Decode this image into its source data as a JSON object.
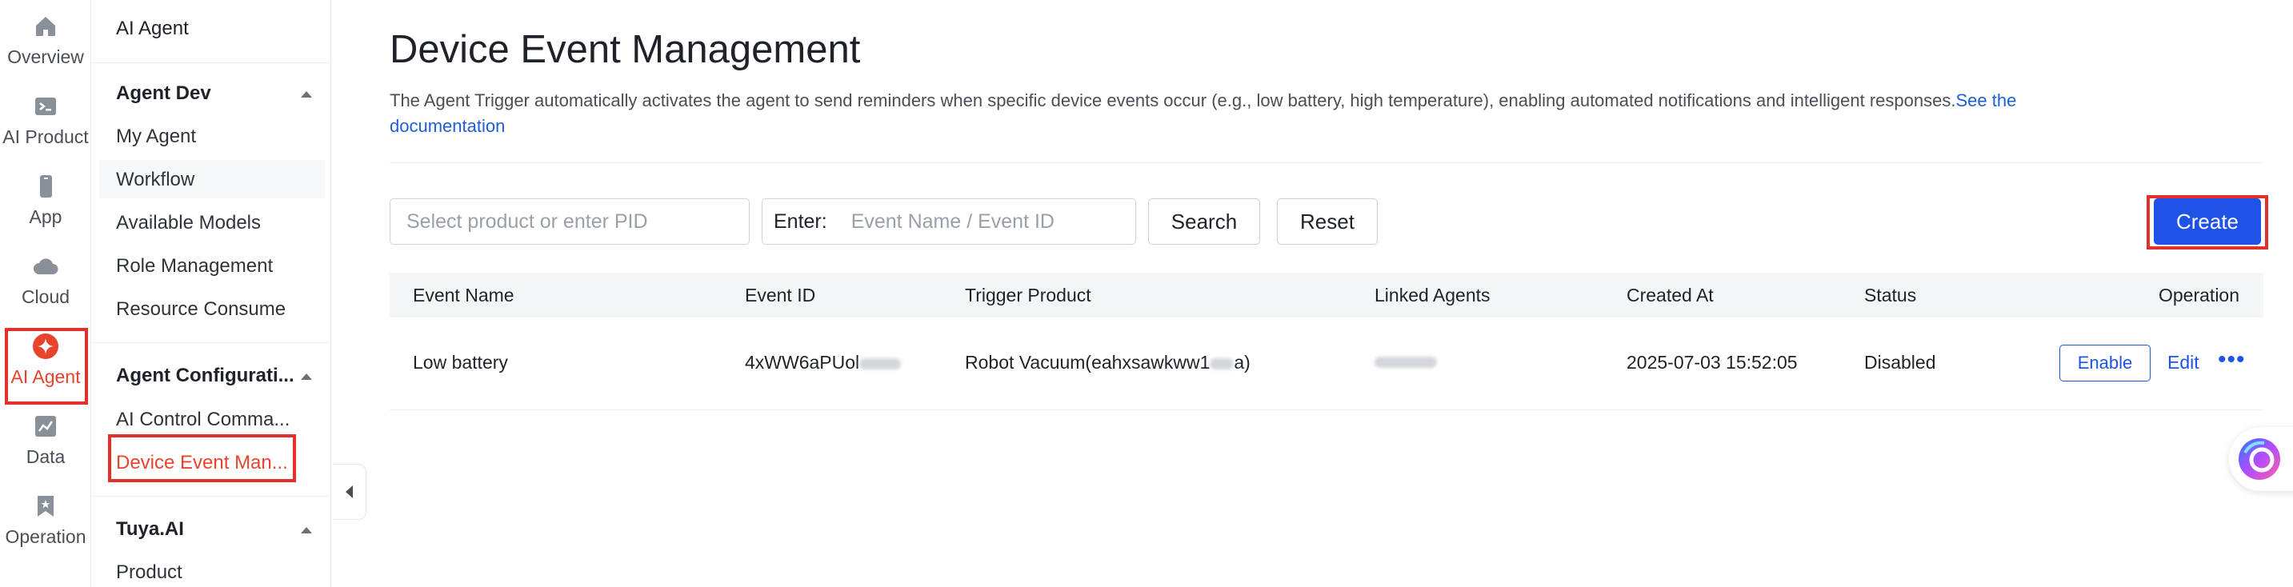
{
  "rail": {
    "items": [
      {
        "label": "Overview",
        "icon": "home-icon"
      },
      {
        "label": "AI Product",
        "icon": "terminal-icon"
      },
      {
        "label": "App",
        "icon": "phone-icon"
      },
      {
        "label": "Cloud",
        "icon": "cloud-icon"
      },
      {
        "label": "AI Agent",
        "icon": "sparkle-icon"
      },
      {
        "label": "Data",
        "icon": "chart-icon"
      },
      {
        "label": "Operation",
        "icon": "bookmark-icon"
      }
    ]
  },
  "sidebar": {
    "title": "AI Agent",
    "groups": [
      {
        "label": "Agent Dev",
        "items": [
          "My Agent",
          "Workflow",
          "Available Models",
          "Role Management",
          "Resource Consume"
        ]
      },
      {
        "label": "Agent Configurati...",
        "items": [
          "AI Control Comma...",
          "Device Event Man..."
        ]
      },
      {
        "label": "Tuya.AI",
        "items": [
          "Product"
        ]
      }
    ]
  },
  "page": {
    "title": "Device Event Management",
    "description": "The Agent Trigger automatically activates the agent to send reminders when specific device events occur (e.g., low battery, high temperature), enabling automated notifications and intelligent responses.",
    "doc_link": "See the documentation"
  },
  "filters": {
    "product_placeholder": "Select product or enter PID",
    "enter_label": "Enter:",
    "event_placeholder": "Event Name / Event ID",
    "search_label": "Search",
    "reset_label": "Reset",
    "create_label": "Create"
  },
  "table": {
    "columns": [
      "Event Name",
      "Event ID",
      "Trigger Product",
      "Linked Agents",
      "Created At",
      "Status",
      "Operation"
    ],
    "rows": [
      {
        "event_name": "Low battery",
        "event_id": "4xWW6aPUol",
        "trigger_product_prefix": "Robot Vacuum(eahxsawkww1",
        "trigger_product_suffix": "a)",
        "created_at": "2025-07-03 15:52:05",
        "status": "Disabled",
        "actions": {
          "enable": "Enable",
          "edit": "Edit",
          "more": "•••"
        }
      }
    ]
  },
  "colors": {
    "accent": "#1f53e6",
    "active": "#e8432d",
    "highlight": "#e3302a"
  }
}
